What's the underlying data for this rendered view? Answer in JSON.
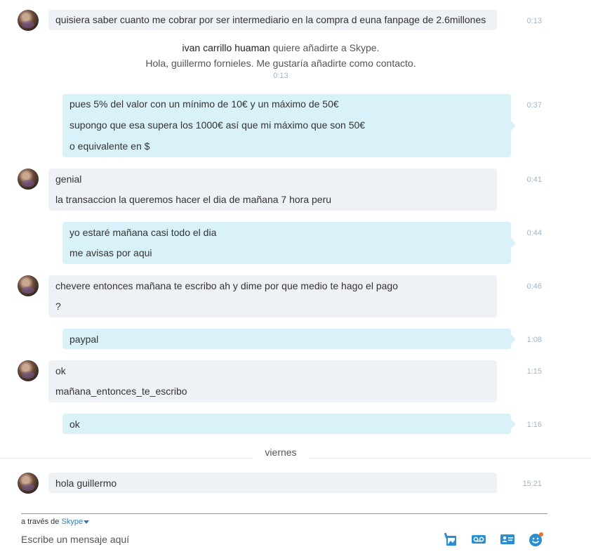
{
  "messages": [
    {
      "dir": "in",
      "lines": [
        "quisiera saber cuanto me cobrar por ser intermediario en la compra d euna fanpage de 2.6millones"
      ],
      "time": "0:13"
    },
    {
      "dir": "out",
      "lines": [
        "pues 5% del valor con un mínimo de 10€ y un máximo de 50€",
        "supongo que esa supera los 1000€ así que mi máximo que son 50€",
        "o equivalente en $"
      ],
      "time": "0:37"
    },
    {
      "dir": "in",
      "lines": [
        "genial",
        "la transaccion la queremos hacer el dia de mañana 7 hora peru"
      ],
      "time": "0:41"
    },
    {
      "dir": "out",
      "lines": [
        "yo estaré mañana casi todo el dia",
        "me avisas por aqui"
      ],
      "time": "0:44"
    },
    {
      "dir": "in",
      "lines": [
        "chevere entonces mañana te escribo ah y dime por que medio te hago el pago",
        "?"
      ],
      "time": "0:46"
    },
    {
      "dir": "out",
      "lines": [
        "paypal"
      ],
      "time": "1:08"
    },
    {
      "dir": "in",
      "lines": [
        "ok",
        "mañana_entonces_te_escribo"
      ],
      "time": "1:15"
    },
    {
      "dir": "out",
      "lines": [
        "ok"
      ],
      "time": "1:16"
    },
    {
      "dir": "in",
      "lines": [
        "hola guillermo"
      ],
      "time": "15:21"
    }
  ],
  "contact_request": {
    "name": "ivan carrillo huaman",
    "action": "quiere añadirte a Skype.",
    "message": "Hola, guillermo fornieles. Me gustaría añadirte como contacto.",
    "time": "0:13"
  },
  "day_separator": "viernes",
  "composer": {
    "via_prefix": "a través de",
    "via_service": "Skype",
    "placeholder": "Escribe un mensaje aquí"
  },
  "toolbar_icons": [
    "image-send-icon",
    "video-message-icon",
    "contact-card-icon",
    "emoticon-icon"
  ],
  "colors": {
    "incoming_bubble": "#eef1f5",
    "outgoing_bubble": "#d9f2fa",
    "accent": "#2a7fb8",
    "timestamp": "#a0b4c8"
  }
}
